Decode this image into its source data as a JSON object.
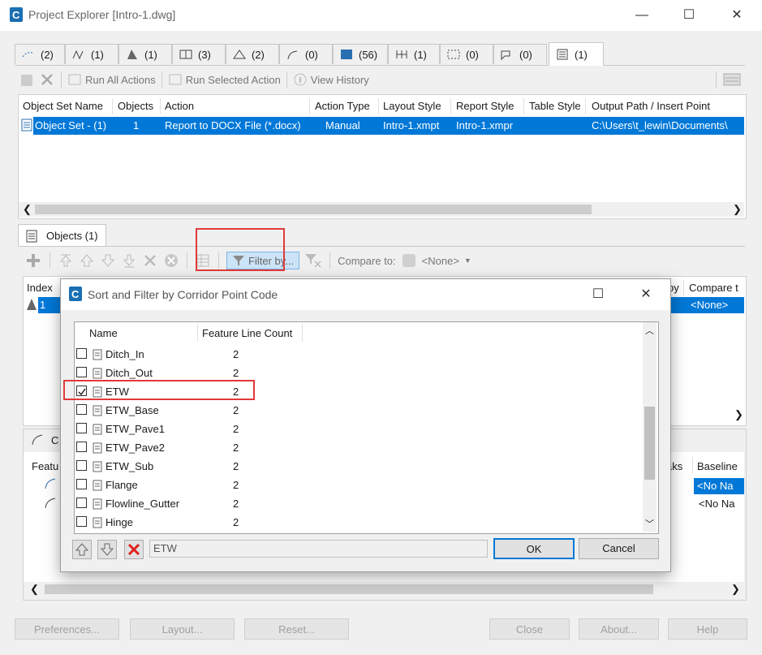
{
  "window": {
    "title": "Project Explorer [Intro-1.dwg]",
    "minimize": "—",
    "maximize": "☐",
    "close": "✕"
  },
  "top_tabs": [
    {
      "count": "(2)"
    },
    {
      "count": "(1)"
    },
    {
      "count": "(1)"
    },
    {
      "count": "(3)"
    },
    {
      "count": "(2)"
    },
    {
      "count": "(0)"
    },
    {
      "count": "(56)"
    },
    {
      "count": "(1)"
    },
    {
      "count": "(0)"
    },
    {
      "count": "(0)"
    },
    {
      "count": "(1)"
    }
  ],
  "toolbar": {
    "run_all": "Run All Actions",
    "run_selected": "Run Selected Action",
    "view_history": "View History"
  },
  "object_sets": {
    "headers": [
      "Object Set Name",
      "Objects",
      "Action",
      "Action Type",
      "Layout Style",
      "Report Style",
      "Table Style",
      "Output Path / Insert Point"
    ],
    "row": [
      "Object Set - (1)",
      "1",
      "Report to DOCX File (*.docx)",
      "Manual",
      "Intro-1.xmpt",
      "Intro-1.xmpr",
      "",
      "C:\\Users\\t_lewin\\Documents\\"
    ]
  },
  "objects_tab": {
    "label": "Objects (1)"
  },
  "objects_toolbar": {
    "filter_by": "Filter by...",
    "compare_to_label": "Compare to:",
    "compare_to_value": "<None>"
  },
  "objects_grid": {
    "index_header": "Index",
    "by_header": "by",
    "compare_header": "Compare t",
    "row_index": "1",
    "row_compare": "<None>"
  },
  "lower_panel": {
    "tab_partial": "C",
    "feature_header": "Featu",
    "breaks_header": "aks",
    "baseline_header": "Baseline",
    "baseline_row1": "<No Na",
    "baseline_row2": "<No Na"
  },
  "bottom_buttons": {
    "preferences": "Preferences...",
    "layout": "Layout...",
    "reset": "Reset...",
    "close": "Close",
    "about": "About...",
    "help": "Help"
  },
  "dialog": {
    "title": "Sort and Filter by Corridor Point Code",
    "col_name": "Name",
    "col_count": "Feature Line Count",
    "items": [
      {
        "name": "Ditch_In",
        "count": "2",
        "checked": false
      },
      {
        "name": "Ditch_Out",
        "count": "2",
        "checked": false
      },
      {
        "name": "ETW",
        "count": "2",
        "checked": true
      },
      {
        "name": "ETW_Base",
        "count": "2",
        "checked": false
      },
      {
        "name": "ETW_Pave1",
        "count": "2",
        "checked": false
      },
      {
        "name": "ETW_Pave2",
        "count": "2",
        "checked": false
      },
      {
        "name": "ETW_Sub",
        "count": "2",
        "checked": false
      },
      {
        "name": "Flange",
        "count": "2",
        "checked": false
      },
      {
        "name": "Flowline_Gutter",
        "count": "2",
        "checked": false
      },
      {
        "name": "Hinge",
        "count": "2",
        "checked": false
      }
    ],
    "filter_value": "ETW",
    "ok": "OK",
    "cancel": "Cancel"
  },
  "colors": {
    "selection": "#0078d7",
    "highlight": "#e03a3a"
  }
}
